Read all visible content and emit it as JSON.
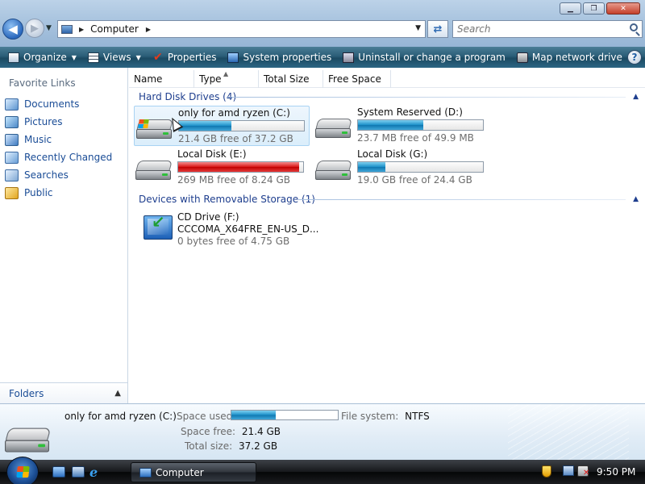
{
  "window": {
    "address_crumbs": [
      "Computer"
    ],
    "search_placeholder": "Search"
  },
  "commandbar": {
    "items": [
      {
        "label": "Organize",
        "has_dropdown": true
      },
      {
        "label": "Views",
        "has_dropdown": true
      },
      {
        "label": "Properties"
      },
      {
        "label": "System properties"
      },
      {
        "label": "Uninstall or change a program"
      },
      {
        "label": "Map network drive"
      }
    ],
    "more_label": "»"
  },
  "navpane": {
    "title": "Favorite Links",
    "items": [
      {
        "label": "Documents",
        "icon": "documents-icon"
      },
      {
        "label": "Pictures",
        "icon": "pictures-icon"
      },
      {
        "label": "Music",
        "icon": "music-icon"
      },
      {
        "label": "Recently Changed",
        "icon": "recently-changed-icon"
      },
      {
        "label": "Searches",
        "icon": "searches-icon"
      },
      {
        "label": "Public",
        "icon": "public-folder-icon"
      }
    ],
    "folders_label": "Folders"
  },
  "columns": [
    "Name",
    "Type",
    "Total Size",
    "Free Space"
  ],
  "groups": [
    {
      "title": "Hard Disk Drives (4)",
      "drives": [
        {
          "name": "only for amd ryzen (C:)",
          "free_text": "21.4 GB free of 37.2 GB",
          "used_fraction": 0.42,
          "selected": true,
          "system": true
        },
        {
          "name": "System Reserved (D:)",
          "free_text": "23.7 MB free of 49.9 MB",
          "used_fraction": 0.52
        },
        {
          "name": "Local Disk (E:)",
          "free_text": "269 MB free of 8.24 GB",
          "used_fraction": 0.97,
          "critical": true
        },
        {
          "name": "Local Disk (G:)",
          "free_text": "19.0 GB free of 24.4 GB",
          "used_fraction": 0.22
        }
      ]
    },
    {
      "title": "Devices with Removable Storage (1)",
      "devices": [
        {
          "name": "CD Drive (F:)",
          "label": "CCCOMA_X64FRE_EN-US_D...",
          "free_text": "0 bytes free of 4.75 GB"
        }
      ]
    }
  ],
  "details": {
    "name": "only for amd ryzen (C:)",
    "space_used_label": "Space used:",
    "space_used_fraction": 0.42,
    "filesystem_label": "File system:",
    "filesystem_value": "NTFS",
    "space_free_label": "Space free:",
    "space_free_value": "21.4 GB",
    "total_size_label": "Total size:",
    "total_size_value": "37.2 GB"
  },
  "taskbar": {
    "task_label": "Computer",
    "clock": "9:50 PM"
  },
  "colors": {
    "accent_blue": "#1a4c96",
    "group_header": "#1e3e8e",
    "bar_normal": "#1b8fc8",
    "bar_critical": "#d81414"
  }
}
